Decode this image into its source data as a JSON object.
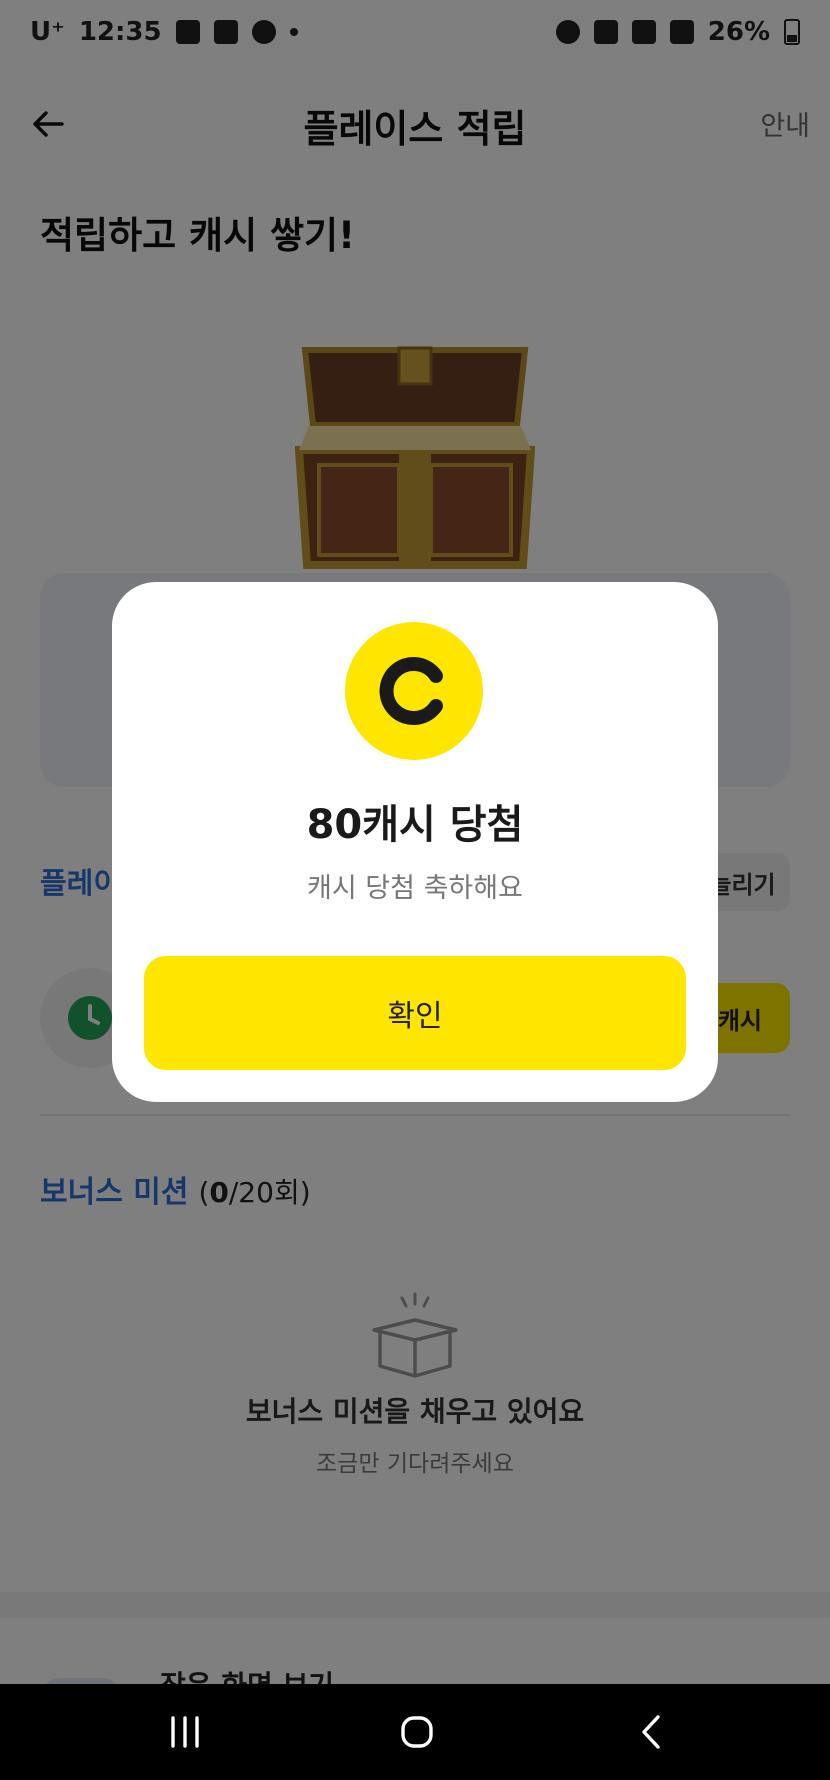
{
  "status_bar": {
    "carrier": "U⁺",
    "time": "12:35",
    "battery": "26%"
  },
  "header": {
    "title": "플레이스 적립",
    "guide_label": "안내"
  },
  "hero": {
    "heading": "적립하고 캐시 쌓기!"
  },
  "place_section": {
    "title_partial": "플레이",
    "pill_partial": "늘리기",
    "cash_partial": "캐시"
  },
  "bonus": {
    "title": "보너스 미션",
    "count_open": "(",
    "count_current": "0",
    "count_rest": "/20회)",
    "empty_title": "보너스 미션을 채우고 있어요",
    "empty_sub": "조금만 기다려주세요"
  },
  "next": {
    "label_partial": "잠은 화면 보기"
  },
  "dialog": {
    "coin_letter": "C",
    "title": "80캐시 당첨",
    "subtitle": "캐시 당첨 축하해요",
    "confirm_label": "확인"
  },
  "colors": {
    "accent_yellow": "#ffe600",
    "section_blue": "#2e6fd6"
  },
  "icons": [
    "back-arrow-icon",
    "treasure-chest-icon",
    "clock-icon",
    "empty-box-icon",
    "coin-icon",
    "recent-apps-icon",
    "home-icon",
    "nav-back-icon"
  ]
}
